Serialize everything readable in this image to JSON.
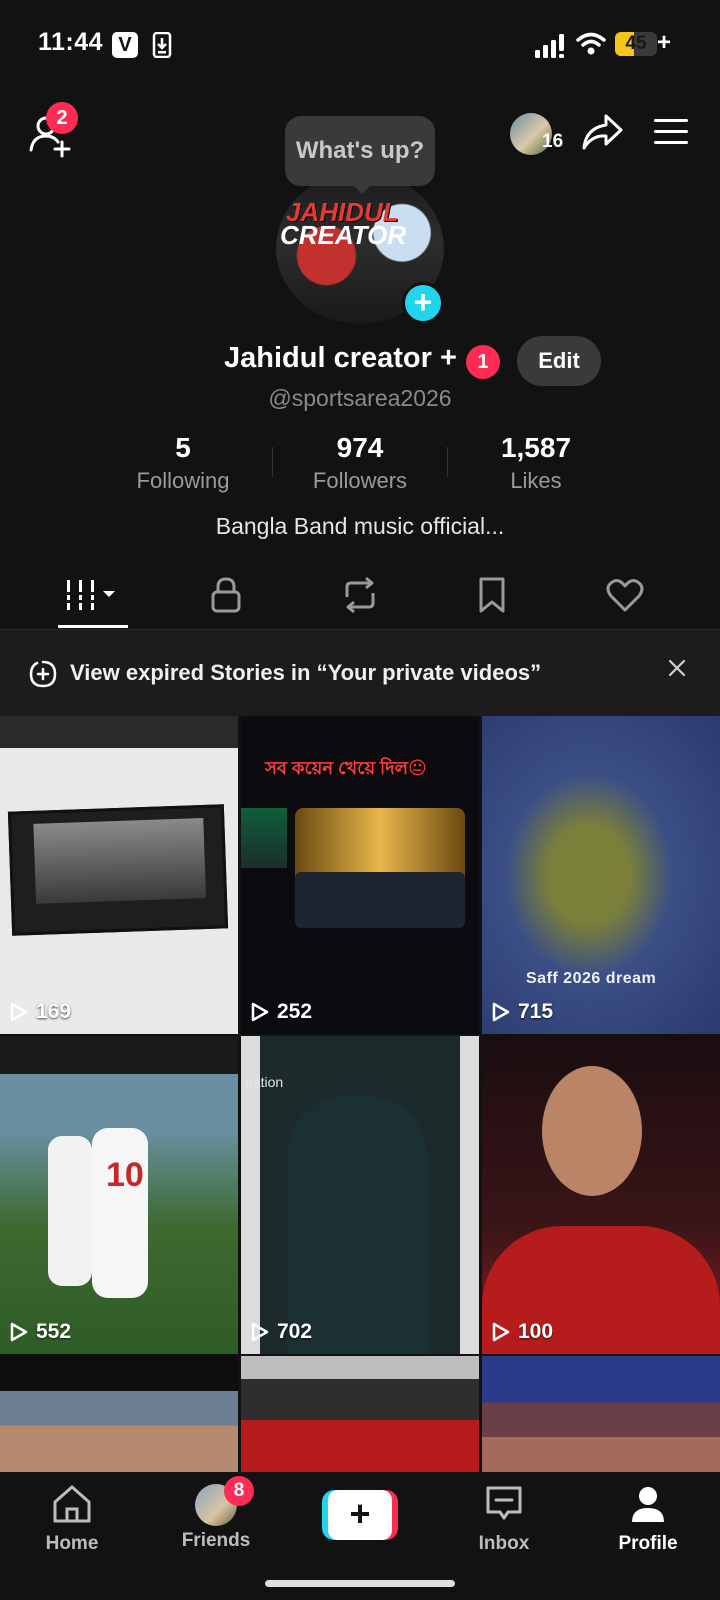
{
  "status_bar": {
    "time": "11:44",
    "battery": "45",
    "battery_level_percent": 45
  },
  "header": {
    "add_friend_badge": "2",
    "mini_avatar_count": "16",
    "status_bubble": "What's up?"
  },
  "profile": {
    "avatar_title_line1": "JAHIDUL",
    "avatar_title_line2": "CREATOR",
    "name": "Jahidul creator +",
    "name_badge": "1",
    "edit_label": "Edit",
    "handle": "@sportsarea2026",
    "stats": [
      {
        "value": "5",
        "label": "Following"
      },
      {
        "value": "974",
        "label": "Followers"
      },
      {
        "value": "1,587",
        "label": "Likes"
      }
    ],
    "bio": "Bangla Band music official..."
  },
  "tabs": [
    "videos-icon",
    "lock-icon",
    "repost-icon",
    "bookmark-icon",
    "heart-icon"
  ],
  "banner": {
    "text": "View expired Stories in “Your private videos”"
  },
  "grid": [
    {
      "views": "169",
      "caption": ""
    },
    {
      "views": "252",
      "caption": "সব কয়েন খেয়ে দিল😐"
    },
    {
      "views": "715",
      "caption": "Saff 2026 dream"
    },
    {
      "views": "552",
      "caption": ""
    },
    {
      "views": "702",
      "caption": "nation"
    },
    {
      "views": "100",
      "caption": ""
    }
  ],
  "nav": {
    "home": "Home",
    "friends": "Friends",
    "friends_badge": "8",
    "inbox": "Inbox",
    "profile": "Profile"
  },
  "colors": {
    "accent_red": "#fe2c55",
    "accent_cyan": "#20d5ec",
    "background": "#121212"
  }
}
